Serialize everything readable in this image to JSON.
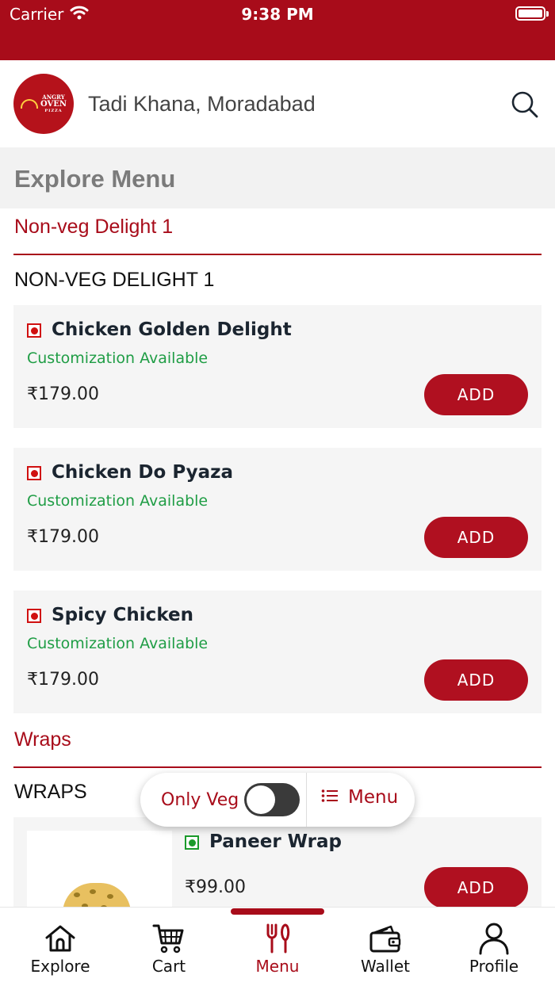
{
  "status_bar": {
    "carrier": "Carrier",
    "time": "9:38 PM"
  },
  "header": {
    "logo_text": [
      "ANGRY",
      "OVEN",
      "PIZZA"
    ],
    "location": "Tadi Khana, Moradabad",
    "search_icon": "search-icon"
  },
  "explore": {
    "title": "Explore Menu"
  },
  "sections": [
    {
      "category": "Non-veg Delight 1",
      "subheading": "NON-VEG DELIGHT 1",
      "items": [
        {
          "name": "Chicken Golden Delight",
          "customization": "Customization Available",
          "price": "₹179.00",
          "button": "ADD",
          "type": "non-veg"
        },
        {
          "name": "Chicken Do Pyaza",
          "customization": "Customization Available",
          "price": "₹179.00",
          "button": "ADD",
          "type": "non-veg"
        },
        {
          "name": "Spicy Chicken",
          "customization": "Customization Available",
          "price": "₹179.00",
          "button": "ADD",
          "type": "non-veg"
        }
      ]
    },
    {
      "category": "Wraps",
      "subheading": "WRAPS",
      "items": [
        {
          "name": "Paneer Wrap",
          "price": "₹99.00",
          "button": "ADD",
          "type": "veg"
        }
      ]
    }
  ],
  "floating_controls": {
    "only_veg_label": "Only Veg",
    "only_veg_enabled": false,
    "menu_label": "Menu",
    "menu_icon": "list-icon"
  },
  "tab_bar": {
    "active": "Menu",
    "tabs": [
      {
        "label": "Explore",
        "icon": "home-icon"
      },
      {
        "label": "Cart",
        "icon": "cart-icon"
      },
      {
        "label": "Menu",
        "icon": "fork-knife-icon"
      },
      {
        "label": "Wallet",
        "icon": "wallet-icon"
      },
      {
        "label": "Profile",
        "icon": "user-icon"
      }
    ]
  },
  "colors": {
    "brand_red": "#a80c1a",
    "customization_green": "#1f9d45",
    "non_veg_red": "#d01010",
    "veg_green": "#1a9a2a"
  }
}
